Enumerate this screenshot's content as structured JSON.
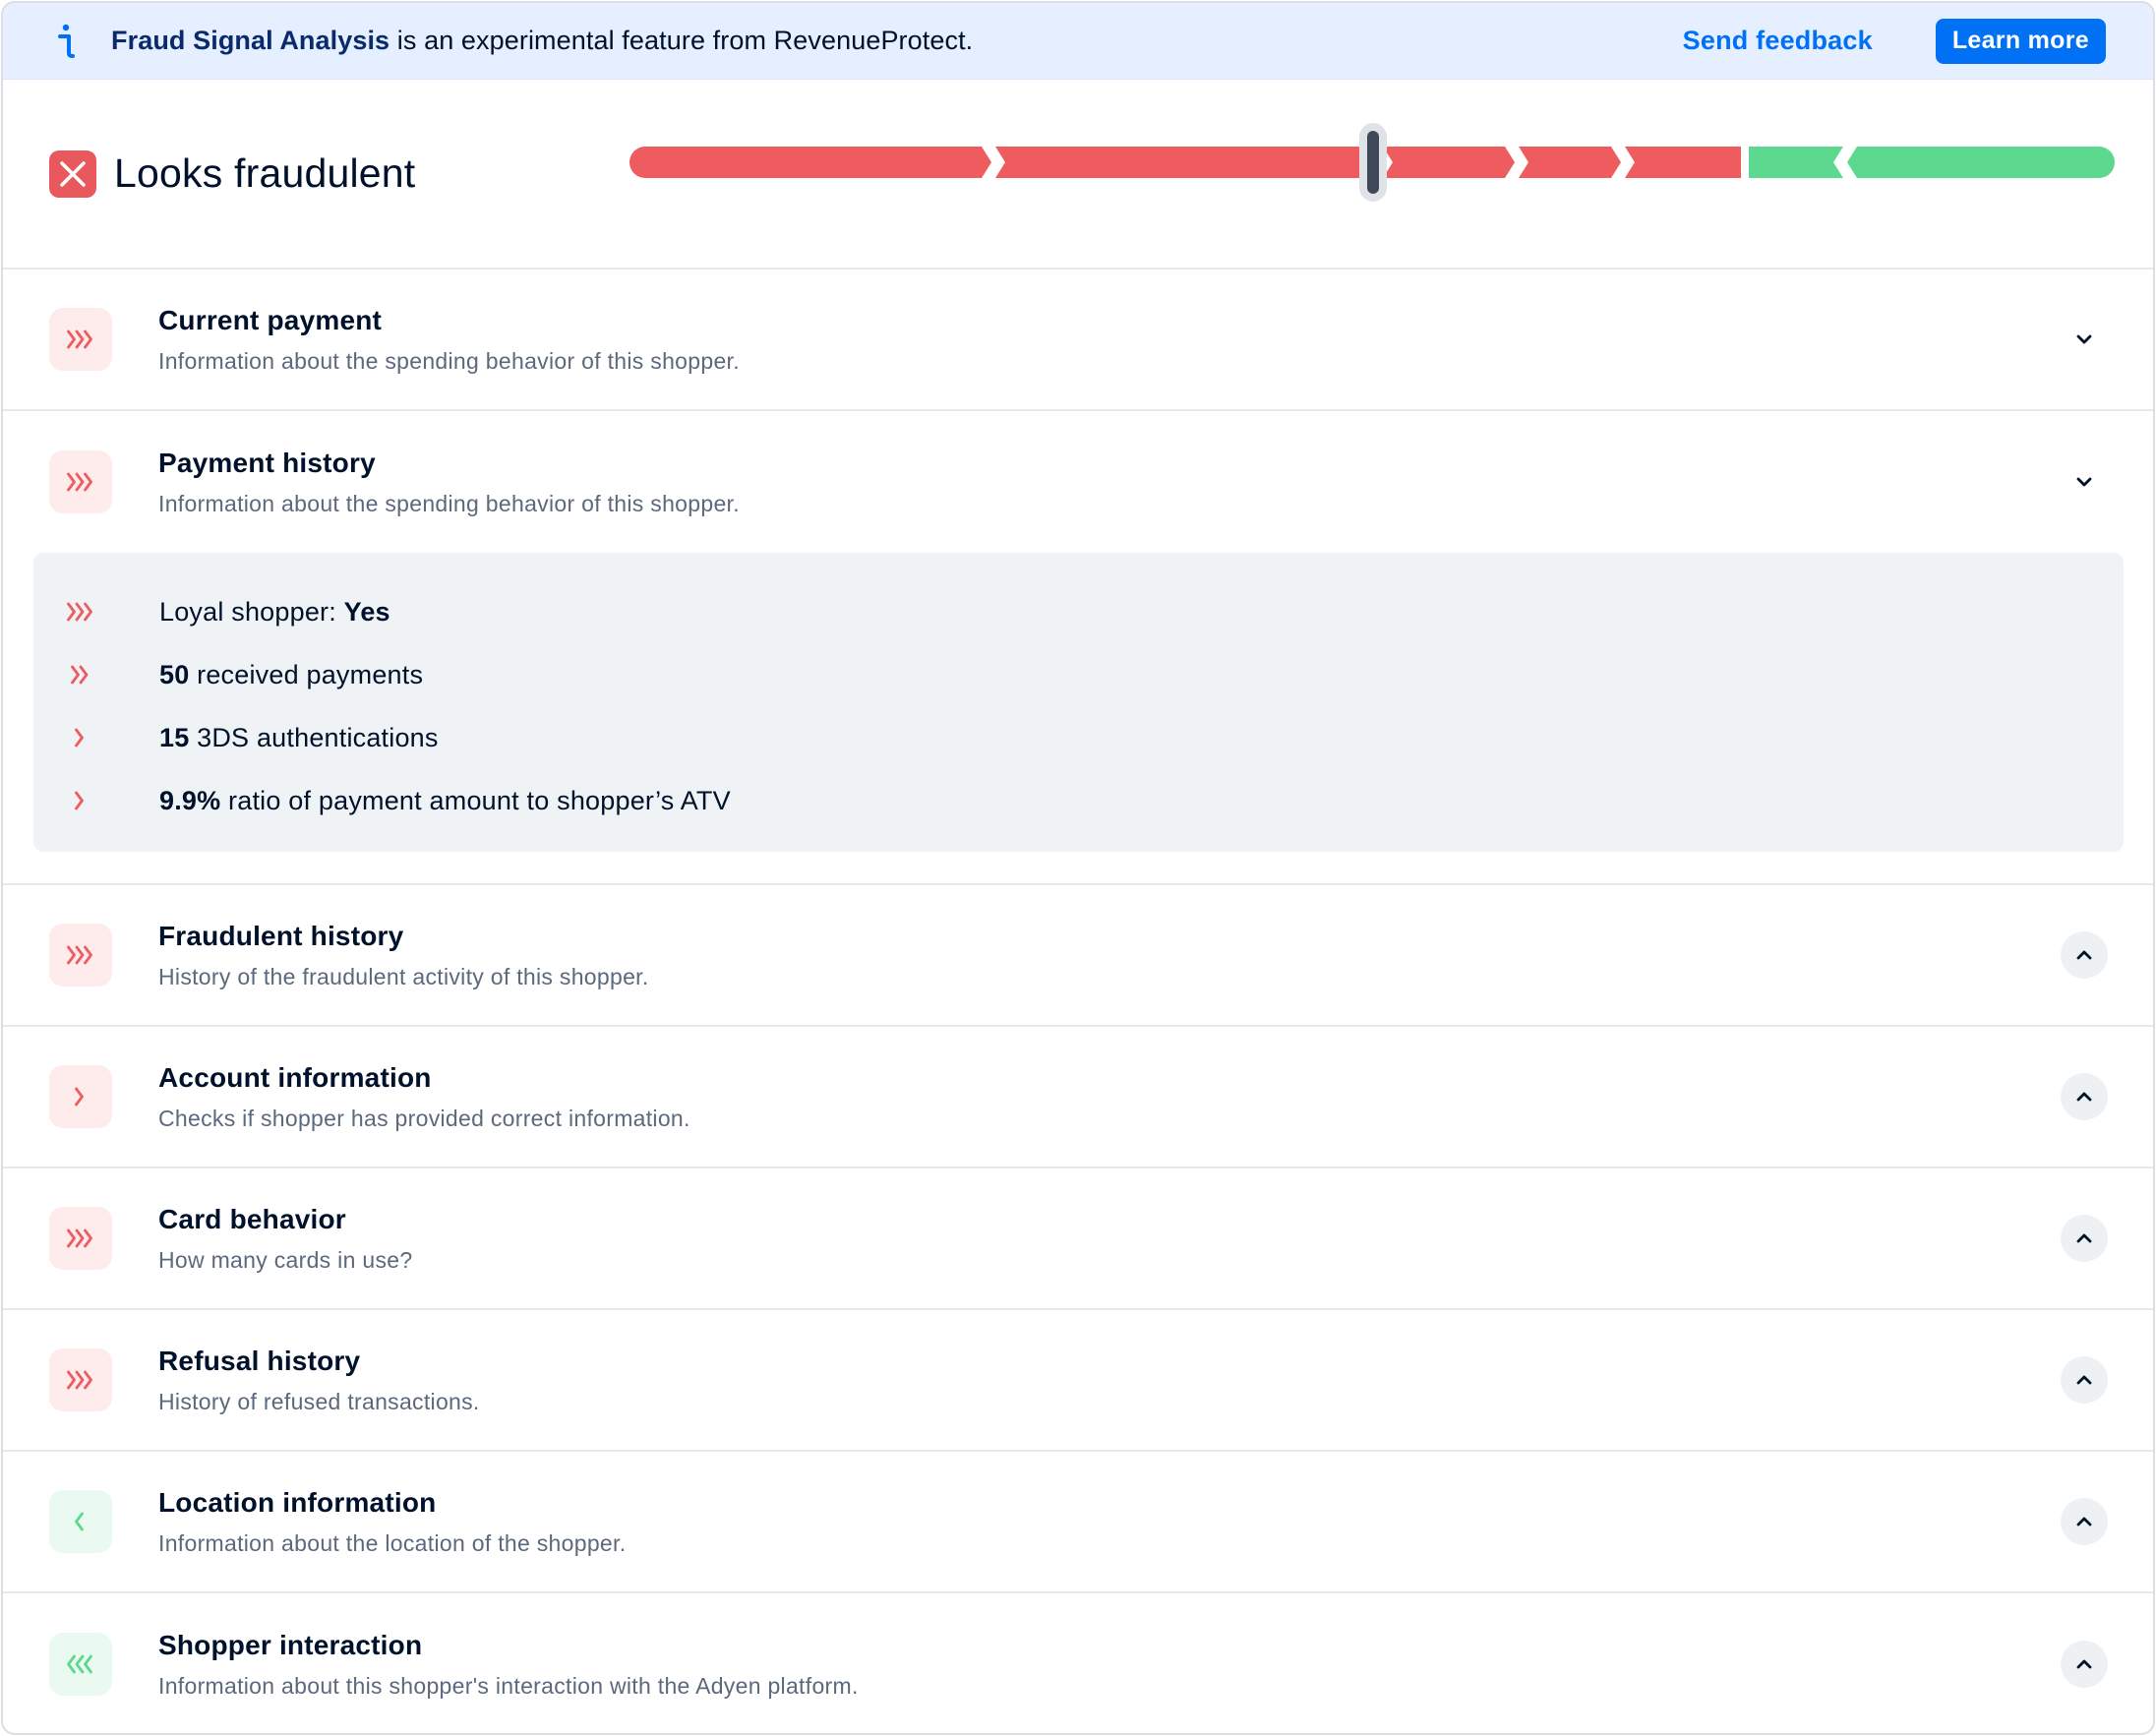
{
  "banner": {
    "feature_name": "Fraud Signal Analysis",
    "message": " is an experimental feature from RevenueProtect.",
    "send_feedback": "Send feedback",
    "learn_more": "Learn more"
  },
  "verdict": {
    "title": "Looks fraudulent",
    "score_fraction": 0.5
  },
  "sections": [
    {
      "title": "Current payment",
      "desc": "Information about the spending behavior of this shopper.",
      "signal": "red",
      "strength": 3,
      "toggle": "down"
    },
    {
      "title": "Payment history",
      "desc": "Information about the spending behavior of this shopper.",
      "signal": "red",
      "strength": 3,
      "toggle": "down"
    },
    {
      "title": "Fraudulent history",
      "desc": "History of the fraudulent activity of this shopper.",
      "signal": "red",
      "strength": 3,
      "toggle": "up"
    },
    {
      "title": "Account information",
      "desc": "Checks if shopper has provided correct information.",
      "signal": "red",
      "strength": 1,
      "toggle": "up"
    },
    {
      "title": "Card behavior",
      "desc": "How many cards in use?",
      "signal": "red",
      "strength": 3,
      "toggle": "up"
    },
    {
      "title": "Refusal history",
      "desc": "History of refused transactions.",
      "signal": "red",
      "strength": 3,
      "toggle": "up"
    },
    {
      "title": "Location information",
      "desc": "Information about the location of the shopper.",
      "signal": "green",
      "strength": 1,
      "toggle": "up"
    },
    {
      "title": "Shopper interaction",
      "desc": "Information about this shopper's interaction with the Adyen platform.",
      "signal": "green",
      "strength": 3,
      "toggle": "up"
    }
  ],
  "payment_history_details": [
    {
      "strength": 3,
      "label": "Loyal shopper: ",
      "value": "Yes",
      "value_first": false
    },
    {
      "strength": 2,
      "label": " received payments",
      "value": "50",
      "value_first": true
    },
    {
      "strength": 1,
      "label": " 3DS authentications",
      "value": "15",
      "value_first": true
    },
    {
      "strength": 1,
      "label": " ratio of payment amount to shopper’s ATV",
      "value": "9.9%",
      "value_first": true
    }
  ],
  "colors": {
    "fraud": "#ef5c5f",
    "safe": "#5cd88f",
    "accent": "#0070f5"
  },
  "icons": {
    "info": "info-icon",
    "verdict": "close-icon",
    "expand": "chevron-down-icon",
    "collapse": "chevron-up-icon"
  }
}
